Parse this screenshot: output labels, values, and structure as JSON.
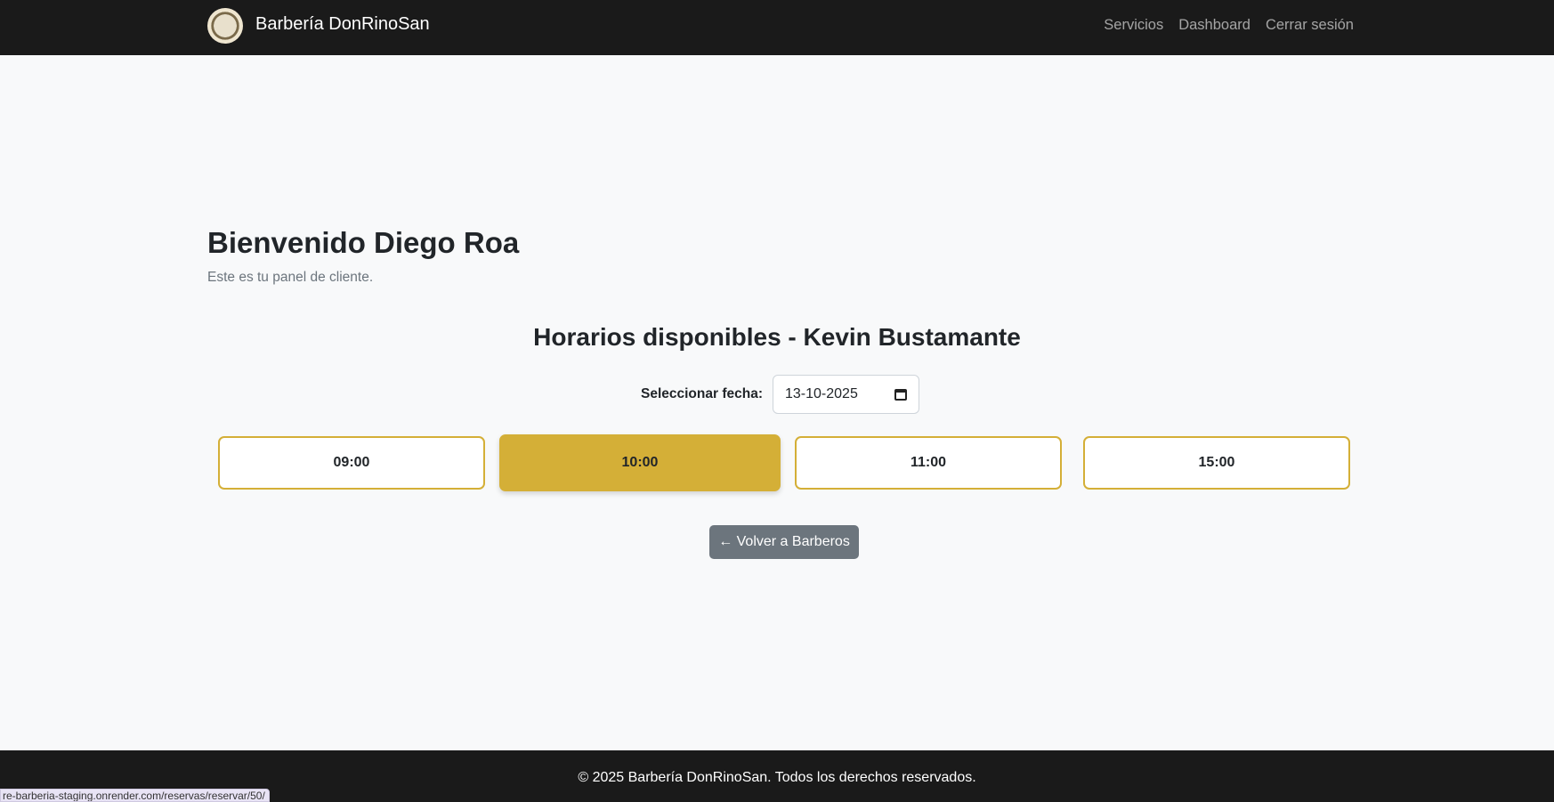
{
  "navbar": {
    "brand": "Barbería DonRinoSan",
    "links": [
      "Servicios",
      "Dashboard",
      "Cerrar sesión"
    ]
  },
  "main": {
    "title": "Bienvenido Diego Roa",
    "subtitle": "Este es tu panel de cliente.",
    "schedule_title": "Horarios disponibles - Kevin Bustamante",
    "date_label": "Seleccionar fecha:",
    "date_value": "13-10-2025",
    "slots": [
      "09:00",
      "10:00",
      "11:00",
      "15:00"
    ],
    "selected_slot": "10:00",
    "back_label": "← Volver a Barberos"
  },
  "colors": {
    "accent": "#d4af37",
    "nav_bg": "#1a1a1a",
    "secondary": "#6c757d"
  },
  "footer": {
    "text": "© 2025 Barbería DonRinoSan. Todos los derechos reservados."
  },
  "status_bar": {
    "url": "re-barberia-staging.onrender.com/reservas/reservar/50/"
  }
}
